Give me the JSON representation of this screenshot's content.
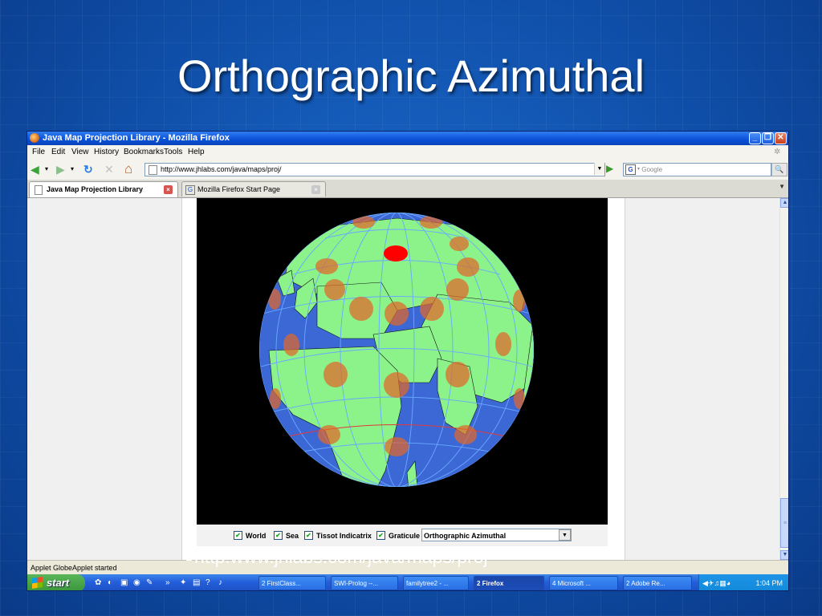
{
  "slide": {
    "title": "Orthographic Azimuthal",
    "link_text": "http:www.jhlabs.com/java/maps/proj"
  },
  "window": {
    "title": "Java Map Projection Library - Mozilla Firefox",
    "min": "_",
    "max": "❐",
    "close": "✕"
  },
  "menu": [
    "File",
    "Edit",
    "View",
    "History",
    "Bookmarks",
    "Tools",
    "Help"
  ],
  "nav": {
    "back": "◀",
    "forward": "▶",
    "reload": "↻",
    "stop": "✕",
    "home": "⌂",
    "url": "http://www.jhlabs.com/java/maps/proj/",
    "search_placeholder": "Google",
    "search_engine": "G",
    "search_go": "🔍"
  },
  "tabs": [
    {
      "label": "Java Map Projection Library",
      "active": true
    },
    {
      "label": "Mozilla Firefox Start Page",
      "active": false
    }
  ],
  "applet": {
    "checkboxes": [
      {
        "label": "World",
        "checked": true
      },
      {
        "label": "Sea",
        "checked": true
      },
      {
        "label": "Tissot Indicatrix",
        "checked": true
      },
      {
        "label": "Graticule",
        "checked": true
      }
    ],
    "check_mark": "✔",
    "projection": "Orthographic Azimuthal",
    "select_arrow": "▼"
  },
  "status": "Applet GlobeApplet started",
  "taskbar": {
    "start": "start",
    "tasks": [
      {
        "label": "2 FirstClass..."
      },
      {
        "label": "SWI-Prolog --..."
      },
      {
        "label": "familytree2 - ..."
      },
      {
        "label": "2 Firefox",
        "active": true
      },
      {
        "label": "4 Microsoft ..."
      },
      {
        "label": "2 Adobe Re..."
      }
    ],
    "clock": "1:04 PM"
  },
  "colors": {
    "ocean": "#3c68d6",
    "land": "#8cf28a",
    "tissot": "#e0662a",
    "pole": "#ff0000",
    "slide_bg": "#1457b8"
  }
}
